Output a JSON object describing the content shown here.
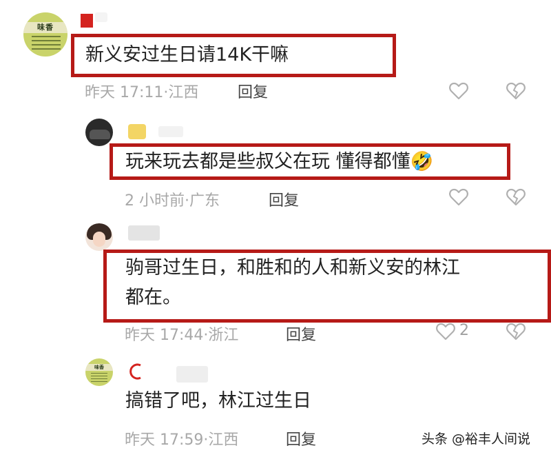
{
  "comments": [
    {
      "text": "新义安过生日请14K干嘛",
      "time": "昨天 17:11",
      "location": "江西",
      "reply_label": "回复"
    },
    {
      "text": "玩来玩去都是些叔父在玩 懂得都懂",
      "emoji": "🤣",
      "time": "2 小时前",
      "location": "广东",
      "reply_label": "回复"
    },
    {
      "text_line1": "驹哥过生日，和胜和的人和新义安的林江",
      "text_line2": "都在。",
      "time": "昨天 17:44",
      "location": "浙江",
      "reply_label": "回复",
      "like_count": "2"
    },
    {
      "text": "搞错了吧，林江过生日",
      "time": "昨天 17:59",
      "location": "江西",
      "reply_label": "回复"
    }
  ],
  "avatar_sign_text": "味香",
  "separator": "·",
  "watermark": "头条 @裕丰人间说",
  "colors": {
    "highlight_border": "#b61a17",
    "meta_text": "#a8a8a8"
  },
  "icons": [
    "heart-outline-icon",
    "broken-heart-icon"
  ]
}
